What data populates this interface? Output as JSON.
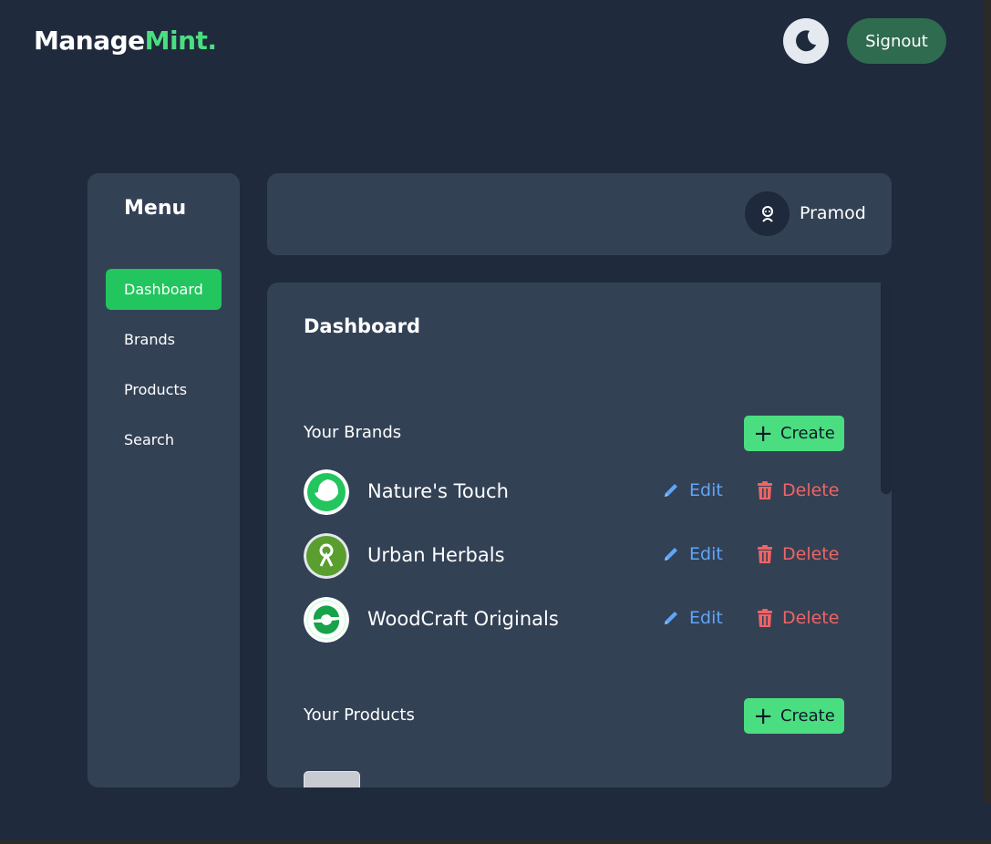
{
  "header": {
    "logo_main": "Manage",
    "logo_accent": "Mint.",
    "signout_label": "Signout"
  },
  "sidebar": {
    "title": "Menu",
    "items": [
      {
        "label": "Dashboard",
        "active": true
      },
      {
        "label": "Brands",
        "active": false
      },
      {
        "label": "Products",
        "active": false
      },
      {
        "label": "Search",
        "active": false
      }
    ]
  },
  "user": {
    "name": "Pramod"
  },
  "main": {
    "title": "Dashboard",
    "brands_section": {
      "title": "Your Brands",
      "create_label": "Create",
      "edit_label": "Edit",
      "delete_label": "Delete",
      "items": [
        {
          "name": "Nature's Touch",
          "icon": "leaf-logo-icon"
        },
        {
          "name": "Urban Herbals",
          "icon": "herb-logo-icon"
        },
        {
          "name": "WoodCraft Originals",
          "icon": "swirl-logo-icon"
        }
      ]
    },
    "products_section": {
      "title": "Your Products",
      "create_label": "Create"
    }
  },
  "colors": {
    "background": "#1f2a3c",
    "panel": "#334155",
    "accent": "#4ade80",
    "active_nav": "#22c55e",
    "signout": "#2f6b4f",
    "edit": "#60a5fa",
    "delete": "#ef6464"
  }
}
